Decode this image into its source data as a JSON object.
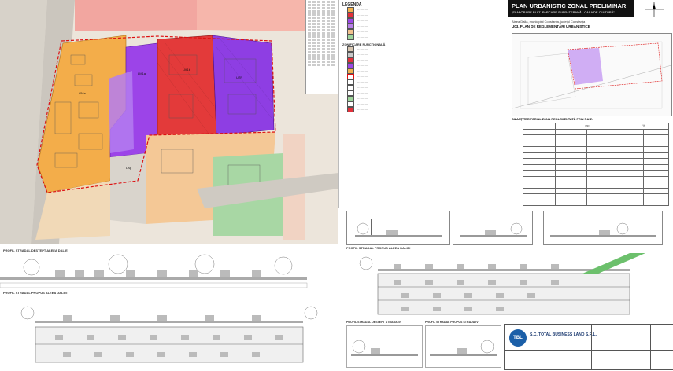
{
  "title": {
    "main": "PLAN URBANISTIC ZONAL PRELIMINAR",
    "subtitle": "„ELABORARE P.U.Z. PARCARE SUPRATERANĂ - CASA DE CULTURĂ”",
    "location": "Aleea Dalia, municipiul Constanța, județul Constanța",
    "drawing_title": "U03. PLAN DE REGLEMENTĂRI URBANISTICE"
  },
  "legend": {
    "heading": "LEGENDA",
    "zones_heading": "ZONIFICARE FUNCȚIONALĂ",
    "items": [
      {
        "color": "#f3b24f"
      },
      {
        "color": "#e3303a"
      },
      {
        "color": "#9b47e6"
      },
      {
        "color": "#b77fe8"
      },
      {
        "color": "#f2c28e"
      },
      {
        "color": "#9fd59c"
      },
      {
        "color": "#d8c7b2"
      },
      {
        "color": "#c7c7c7"
      }
    ]
  },
  "map": {
    "zone_labels": [
      "LM1a",
      "LM1b",
      "UTR",
      "GMa",
      "LAp"
    ],
    "colors": {
      "orange": "#f3ad4a",
      "red": "#e33a3a",
      "purple": "#9c44e8",
      "lilac": "#b47cf0",
      "peach": "#f4c896",
      "green": "#a8d7a4",
      "grey": "#cfcbc4",
      "boundary": "#d11"
    }
  },
  "bilant": {
    "heading": "BILANȚ TERITORIAL ZONA REGLEMENTATĂ PRIN P.U.Z.",
    "columns": [
      "",
      "Situație existentă",
      "",
      "Propunere",
      ""
    ],
    "rows": [
      [
        "Zonă",
        "mp",
        "%",
        "mp",
        "%"
      ]
    ]
  },
  "profiles": {
    "p1": "PROFIL STRADAL DESTEPT ALEEA DALIEI",
    "p2": "PROFIL STRADAL PROPUS ALEEA DALIEI",
    "p3": "PROFIL STRADAL PROPUS ALEEA DALIEI",
    "p4": "PROFIL STRADAL DESTEPT STRADA IV",
    "p5": "PROFIL STRADAL PROPUS STRADA IV"
  },
  "company": {
    "name": "S.C. TOTAL BUSINESS LAND S.R.L.",
    "logo": "TBL"
  },
  "compass": "compass-rose-icon"
}
